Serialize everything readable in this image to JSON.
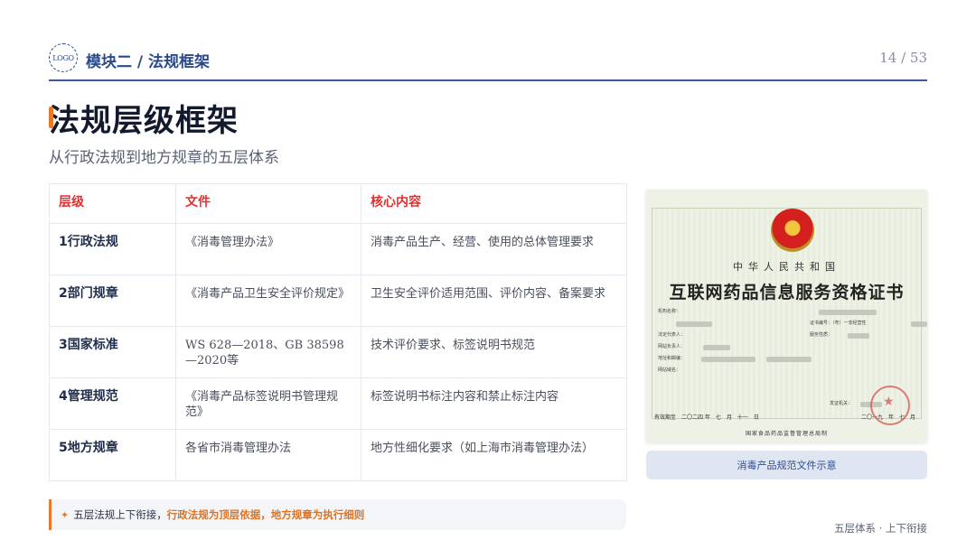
{
  "header": {
    "logo_text": "LOGO",
    "module": "模块二 / 法规框架",
    "page_current": "14",
    "page_sep": " / ",
    "page_total": "53"
  },
  "title": "法规层级框架",
  "subtitle": "从行政法规到地方规章的五层体系",
  "table": {
    "headers": [
      "层级",
      "文件",
      "核心内容"
    ],
    "rows": [
      {
        "level": "1行政法规",
        "doc": "《消毒管理办法》",
        "core": "消毒产品生产、经营、使用的总体管理要求"
      },
      {
        "level": "2部门规章",
        "doc": "《消毒产品卫生安全评价规定》",
        "core": "卫生安全评价适用范围、评价内容、备案要求"
      },
      {
        "level": "3国家标准",
        "doc": "WS 628—2018、GB 38598—2020等",
        "core": "技术评价要求、标签说明书规范"
      },
      {
        "level": "4管理规范",
        "doc": "《消毒产品标签说明书管理规范》",
        "core": "标签说明书标注内容和禁止标注内容"
      },
      {
        "level": "5地方规章",
        "doc": "各省市消毒管理办法",
        "core": "地方性细化要求（如上海市消毒管理办法）"
      }
    ]
  },
  "certificate": {
    "country": "中华人民共和国",
    "title": "互联网药品信息服务资格证书",
    "cert_no_label": "证书编号：（粤）一非经营性",
    "service_label": "服务性质：",
    "fields": [
      "机构名称：",
      "法定代表人：",
      "网站负责人：",
      "地址和邮编：",
      "网站域名："
    ],
    "issuer_label": "发证机关：",
    "valid_until": "有效期至　二〇二四 年　七　月　十一　日",
    "issue_date": "二〇一九　年　七　月",
    "org": "国家食品药品监督管理总局制"
  },
  "caption": "消毒产品规范文件示意",
  "note": {
    "prefix": "五层法规上下衔接，",
    "highlight": "行政法规为顶层依据，地方规章为执行细则"
  },
  "footer": "五层体系 · 上下衔接",
  "colors": {
    "accent_blue": "#2a4a8c",
    "header_red": "#e0312f",
    "accent_orange": "#e87a2a"
  }
}
